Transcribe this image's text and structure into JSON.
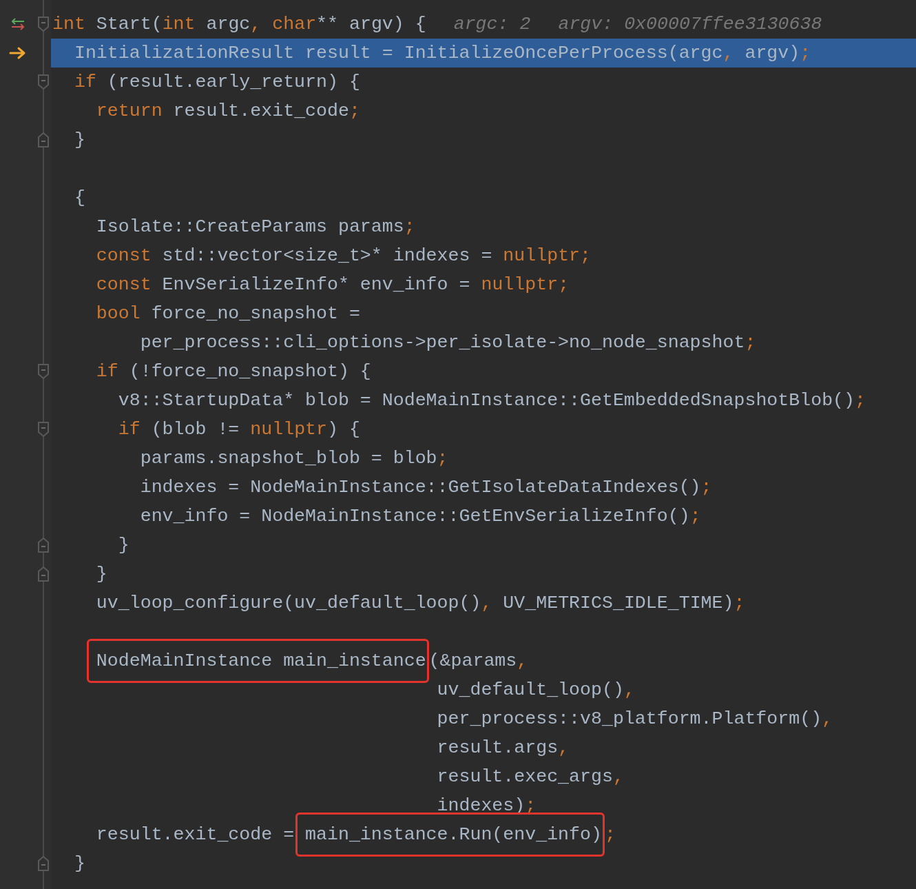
{
  "editor": {
    "lines": [
      {
        "current": false,
        "kind": "changed-fold-start",
        "tokens": [
          {
            "kind": "kw",
            "text": "int"
          },
          {
            "kind": "plain",
            "text": " Start("
          },
          {
            "kind": "kw",
            "text": "int"
          },
          {
            "kind": "plain",
            "text": " argc"
          },
          {
            "kind": "punct",
            "text": ","
          },
          {
            "kind": "kw",
            "text": " char"
          },
          {
            "kind": "plain",
            "text": "** argv) {"
          },
          {
            "kind": "hint",
            "text": "argc: 2"
          },
          {
            "kind": "hint",
            "text": "argv: 0x00007ffee3130638"
          }
        ]
      },
      {
        "current": true,
        "kind": "plain",
        "tokens": [
          {
            "kind": "plain",
            "text": "  InitializationResult result = InitializeOncePerProcess(argc"
          },
          {
            "kind": "punct",
            "text": ","
          },
          {
            "kind": "plain",
            "text": " argv)"
          },
          {
            "kind": "punct",
            "text": ";"
          }
        ]
      },
      {
        "current": false,
        "kind": "fold-start",
        "tokens": [
          {
            "kind": "kw",
            "text": "  if"
          },
          {
            "kind": "plain",
            "text": " (result.early_return) {"
          }
        ]
      },
      {
        "current": false,
        "kind": "plain",
        "tokens": [
          {
            "kind": "kw",
            "text": "    return"
          },
          {
            "kind": "plain",
            "text": " result.exit_code"
          },
          {
            "kind": "punct",
            "text": ";"
          }
        ]
      },
      {
        "current": false,
        "kind": "fold-end",
        "tokens": [
          {
            "kind": "plain",
            "text": "  }"
          }
        ]
      },
      {
        "current": false,
        "kind": "plain"
      },
      {
        "current": false,
        "kind": "plain",
        "tokens": [
          {
            "kind": "plain",
            "text": "  {"
          }
        ]
      },
      {
        "current": false,
        "kind": "plain",
        "tokens": [
          {
            "kind": "plain",
            "text": "    Isolate::CreateParams params"
          },
          {
            "kind": "punct",
            "text": ";"
          }
        ]
      },
      {
        "current": false,
        "kind": "plain",
        "tokens": [
          {
            "kind": "kw",
            "text": "    const"
          },
          {
            "kind": "plain",
            "text": " std::vector<size_t>* indexes = "
          },
          {
            "kind": "kw",
            "text": "nullptr"
          },
          {
            "kind": "punct",
            "text": ";"
          }
        ]
      },
      {
        "current": false,
        "kind": "plain",
        "tokens": [
          {
            "kind": "kw",
            "text": "    const"
          },
          {
            "kind": "plain",
            "text": " EnvSerializeInfo* env_info = "
          },
          {
            "kind": "kw",
            "text": "nullptr"
          },
          {
            "kind": "punct",
            "text": ";"
          }
        ]
      },
      {
        "current": false,
        "kind": "plain",
        "tokens": [
          {
            "kind": "kw",
            "text": "    bool"
          },
          {
            "kind": "plain",
            "text": " force_no_snapshot ="
          }
        ]
      },
      {
        "current": false,
        "kind": "plain",
        "tokens": [
          {
            "kind": "plain",
            "text": "        per_process::cli_options->per_isolate->no_node_snapshot"
          },
          {
            "kind": "punct",
            "text": ";"
          }
        ]
      },
      {
        "current": false,
        "kind": "fold-start",
        "tokens": [
          {
            "kind": "kw",
            "text": "    if"
          },
          {
            "kind": "plain",
            "text": " (!force_no_snapshot) {"
          }
        ]
      },
      {
        "current": false,
        "kind": "plain",
        "tokens": [
          {
            "kind": "plain",
            "text": "      v8::StartupData* blob = NodeMainInstance::GetEmbeddedSnapshotBlob()"
          },
          {
            "kind": "punct",
            "text": ";"
          }
        ]
      },
      {
        "current": false,
        "kind": "fold-start",
        "tokens": [
          {
            "kind": "kw",
            "text": "      if"
          },
          {
            "kind": "plain",
            "text": " (blob != "
          },
          {
            "kind": "kw",
            "text": "nullptr"
          },
          {
            "kind": "plain",
            "text": ") {"
          }
        ]
      },
      {
        "current": false,
        "kind": "plain",
        "tokens": [
          {
            "kind": "plain",
            "text": "        params.snapshot_blob = blob"
          },
          {
            "kind": "punct",
            "text": ";"
          }
        ]
      },
      {
        "current": false,
        "kind": "plain",
        "tokens": [
          {
            "kind": "plain",
            "text": "        indexes = NodeMainInstance::GetIsolateDataIndexes()"
          },
          {
            "kind": "punct",
            "text": ";"
          }
        ]
      },
      {
        "current": false,
        "kind": "plain",
        "tokens": [
          {
            "kind": "plain",
            "text": "        env_info = NodeMainInstance::GetEnvSerializeInfo()"
          },
          {
            "kind": "punct",
            "text": ";"
          }
        ]
      },
      {
        "current": false,
        "kind": "fold-end",
        "tokens": [
          {
            "kind": "plain",
            "text": "      }"
          }
        ]
      },
      {
        "current": false,
        "kind": "fold-end",
        "tokens": [
          {
            "kind": "plain",
            "text": "    }"
          }
        ]
      },
      {
        "current": false,
        "kind": "plain",
        "tokens": [
          {
            "kind": "plain",
            "text": "    uv_loop_configure(uv_default_loop()"
          },
          {
            "kind": "punct",
            "text": ","
          },
          {
            "kind": "plain",
            "text": " UV_METRICS_IDLE_TIME)"
          },
          {
            "kind": "punct",
            "text": ";"
          }
        ]
      },
      {
        "current": false,
        "kind": "plain"
      },
      {
        "current": false,
        "kind": "plain",
        "tokens": [
          {
            "kind": "boxed",
            "text": "    NodeMainInstance main_instance"
          },
          {
            "kind": "plain",
            "text": "(&params"
          },
          {
            "kind": "punct",
            "text": ","
          }
        ]
      },
      {
        "current": false,
        "kind": "plain",
        "tokens": [
          {
            "kind": "plain",
            "text": "                                   uv_default_loop()"
          },
          {
            "kind": "punct",
            "text": ","
          }
        ]
      },
      {
        "current": false,
        "kind": "plain",
        "tokens": [
          {
            "kind": "plain",
            "text": "                                   per_process::v8_platform.Platform()"
          },
          {
            "kind": "punct",
            "text": ","
          }
        ]
      },
      {
        "current": false,
        "kind": "plain",
        "tokens": [
          {
            "kind": "plain",
            "text": "                                   result.args"
          },
          {
            "kind": "punct",
            "text": ","
          }
        ]
      },
      {
        "current": false,
        "kind": "plain",
        "tokens": [
          {
            "kind": "plain",
            "text": "                                   result.exec_args"
          },
          {
            "kind": "punct",
            "text": ","
          }
        ]
      },
      {
        "current": false,
        "kind": "plain",
        "tokens": [
          {
            "kind": "plain",
            "text": "                                   indexes)"
          },
          {
            "kind": "punct",
            "text": ";"
          }
        ]
      },
      {
        "current": false,
        "kind": "plain",
        "tokens": [
          {
            "kind": "plain",
            "text": "    result.exit_code = "
          },
          {
            "kind": "boxed",
            "text": "main_instance.Run(env_info)"
          },
          {
            "kind": "punct",
            "text": ";"
          }
        ]
      },
      {
        "current": false,
        "kind": "fold-end",
        "tokens": [
          {
            "kind": "plain",
            "text": "  }"
          }
        ]
      }
    ]
  }
}
